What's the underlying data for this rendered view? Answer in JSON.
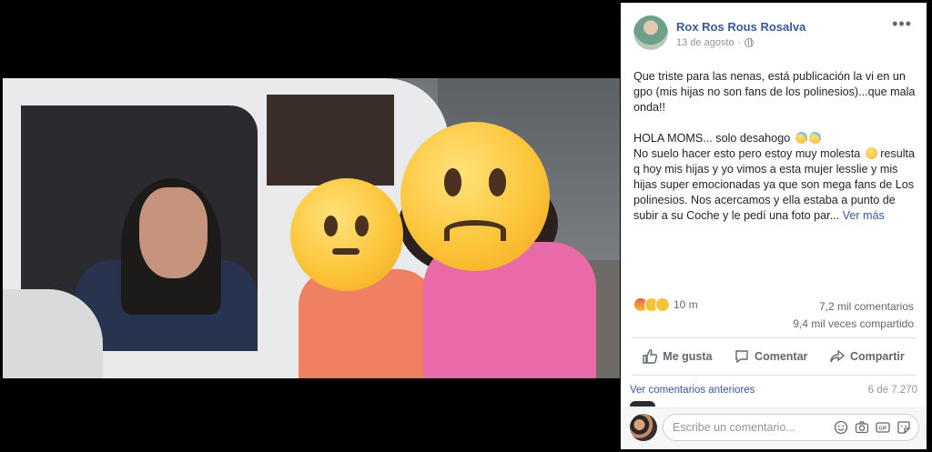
{
  "post": {
    "author": "Rox Ros Rous Rosalva",
    "date": "13 de agosto",
    "date_separator": "·",
    "paragraph1": "Que triste para las nenas, está publicación la vi en un gpo (mis hijas no son fans de los polinesios)...que mala onda!!",
    "paragraph2_line1": "HOLA MOMS... solo desahogo",
    "paragraph2_body_a": "No suelo hacer esto pero estoy muy molesta",
    "paragraph2_body_b": "resulta q hoy mis hijas y yo vimos a esta mujer lesslie y mis hijas super emocionadas ya que son mega fans de Los polinesios. Nos acercamos y ella estaba a punto de subir a su Coche y le pedí una foto par...",
    "see_more": "Ver más",
    "more_options": "•••"
  },
  "stats": {
    "reactions_count": "10 m",
    "comments": "7,2 mil comentarios",
    "shares": "9,4 mil veces compartido"
  },
  "actions": {
    "like": "Me gusta",
    "comment": "Comentar",
    "share": "Compartir"
  },
  "comments": {
    "previous_link": "Ver comentarios anteriores",
    "count": "6 de 7.270",
    "placeholder": "Escribe un comentario..."
  },
  "icons": {
    "globe": "globe-icon",
    "like": "thumbs-up-icon",
    "comment": "speech-bubble-icon",
    "share": "share-arrow-icon",
    "emoji": "smiley-icon",
    "camera": "camera-icon",
    "gif": "gif-icon",
    "sticker": "sticker-icon"
  },
  "colors": {
    "link": "#385898",
    "muted": "#606770",
    "text": "#1d2129"
  }
}
